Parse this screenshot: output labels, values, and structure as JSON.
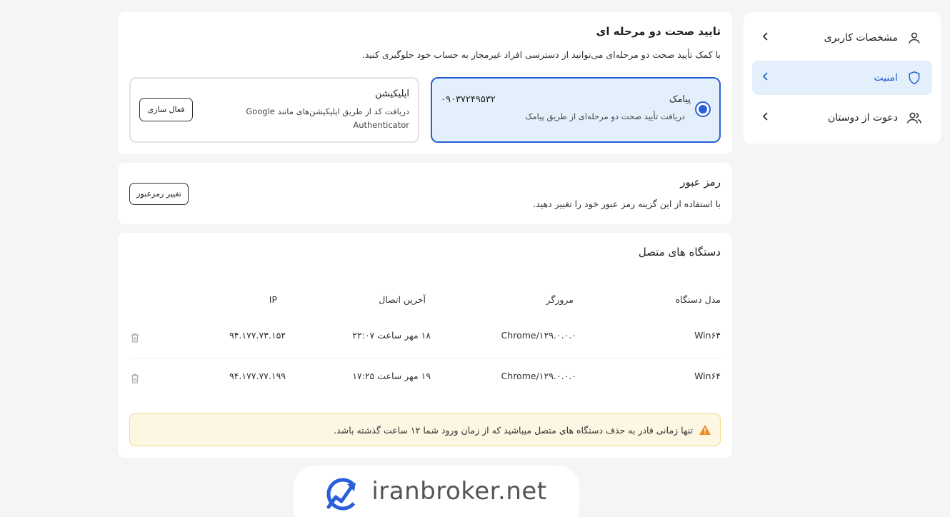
{
  "sidebar": {
    "items": [
      {
        "label": "مشخصات کاربری",
        "icon": "user-icon",
        "active": false
      },
      {
        "label": "امنیت",
        "icon": "shield-icon",
        "active": true
      },
      {
        "label": "دعوت از دوستان",
        "icon": "users-icon",
        "active": false
      }
    ]
  },
  "two_factor": {
    "title": "تایید صحت دو مرحله ای",
    "description": "با کمک تأیید صحت دو مرحله‌ای می‌توانید از دسترسی افراد غیرمجاز به حساب خود جلوگیری کنید.",
    "sms": {
      "title": "پیامک",
      "description": "دریافت تأیید صحت دو مرحله‌ای از طریق پیامک",
      "phone": "۰۹۰۳۷۲۴۹۵۳۲",
      "selected": true
    },
    "app": {
      "title": "اپلیکیشن",
      "description": "دریافت کد از طریق اپلیکیشن‌های مانند Google Authenticator",
      "button_label": "فعال سازی"
    }
  },
  "password": {
    "title": "رمز عبور",
    "description": "با استفاده از این گزینه رمز عبور خود را تغییر دهید.",
    "button_label": "تغییر رمزعبور"
  },
  "devices": {
    "title": "دستگاه های متصل",
    "columns": [
      "مدل دستگاه",
      "مرورگر",
      "آخرین اتصال",
      "IP"
    ],
    "rows": [
      {
        "model": "Win۶۴",
        "browser": "Chrome/۱۲۹.۰.۰.۰",
        "last": "۱۸ مهر ساعت ۲۲:۰۷",
        "ip": "۹۴.۱۷۷.۷۳.۱۵۲"
      },
      {
        "model": "Win۶۴",
        "browser": "Chrome/۱۲۹.۰.۰.۰",
        "last": "۱۹ مهر ساعت ۱۷:۲۵",
        "ip": "۹۴.۱۷۷.۷۷.۱۹۹"
      }
    ],
    "warning": "تنها زمانی قادر به حذف دستگاه های متصل میباشید که از زمان ورود شما ۱۲ ساعت گذشته باشد."
  },
  "watermark": {
    "text": "iranbroker.net"
  },
  "colors": {
    "accent": "#2b5fd9",
    "active_bg": "#e3f0fc",
    "warning_bg": "#fdf6e3",
    "warning_icon": "#f08a24"
  }
}
